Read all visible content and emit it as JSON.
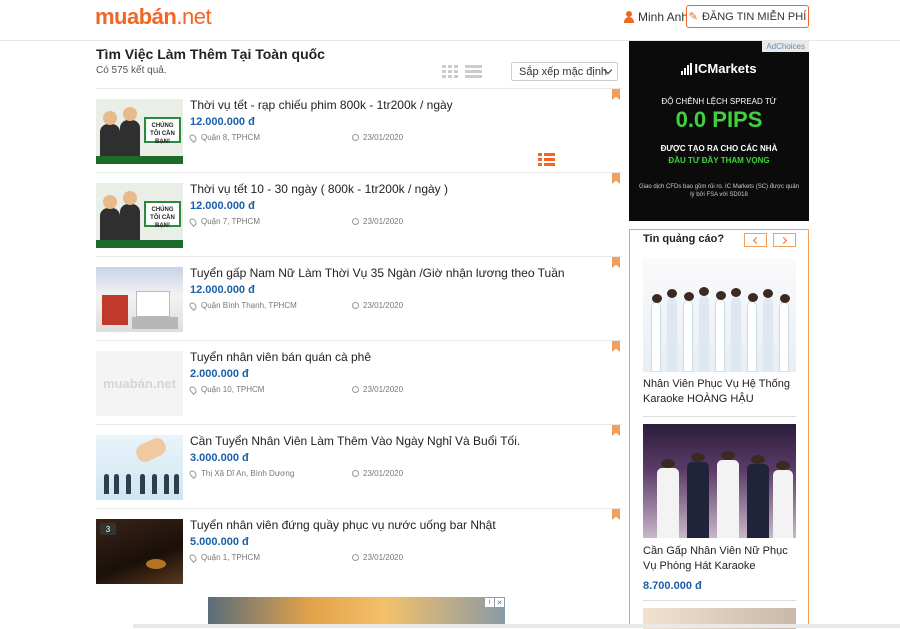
{
  "header": {
    "logo_main": "muabán",
    "logo_tld": ".net",
    "user_name": "Minh Anh",
    "post_button": "ĐĂNG TIN MIỄN PHÍ"
  },
  "listing": {
    "title": "Tìm Việc Làm Thêm Tại Toàn quốc",
    "result_count": "Có 575 kết quả.",
    "sort_label": "Sắp xếp mặc định",
    "items": [
      {
        "title": "Thời vụ tết - rạp chiếu phim 800k - 1tr200k / ngày",
        "price": "12.000.000 đ",
        "location": "Quận 8, TPHCM",
        "date": "23/01/2020",
        "thumb_text": "CHÚNG TÔI CẦN BẠN!"
      },
      {
        "title": "Thời vụ tết 10 - 30 ngày ( 800k - 1tr200k / ngày )",
        "price": "12.000.000 đ",
        "location": "Quận 7, TPHCM",
        "date": "23/01/2020",
        "thumb_text": "CHÚNG TÔI CẦN BẠN!"
      },
      {
        "title": "Tuyển gấp Nam Nữ Làm Thời Vụ 35 Ngàn /Giờ nhận lương theo Tuần",
        "price": "12.000.000 đ",
        "location": "Quận Bình Thạnh, TPHCM",
        "date": "23/01/2020"
      },
      {
        "title": "Tuyển nhân viên bán quán cà phê",
        "price": "2.000.000 đ",
        "location": "Quận 10, TPHCM",
        "date": "23/01/2020",
        "thumb_text": "muabán.net"
      },
      {
        "title": "Cần Tuyển Nhân Viên Làm Thêm Vào Ngày Nghỉ Và Buổi Tối.",
        "price": "3.000.000 đ",
        "location": "Thị Xã Dĩ An, Bình Dương",
        "date": "23/01/2020"
      },
      {
        "title": "Tuyển nhân viên đứng quầy phục vụ nước uống bar Nhật",
        "price": "5.000.000 đ",
        "location": "Quận 1, TPHCM",
        "date": "23/01/2020",
        "badge": "3"
      }
    ]
  },
  "ad_banner": {
    "adchoices": "AdChoices",
    "brand": "ICMarkets",
    "line1": "ĐỘ CHÊNH LỆCH SPREAD TỪ",
    "line2": "0.0 PIPS",
    "line3": "ĐƯỢC TẠO RA CHO CÁC NHÀ",
    "line4": "ĐẦU TƯ ĐẦY THAM VỌNG",
    "line5": "Giao dịch CFDs bao gồm rủi ro. IC Markets (SC) được quản lý bởi FSA với SD018"
  },
  "promo": {
    "heading": "Tin quảng cáo?",
    "items": [
      {
        "caption": "Nhân Viên Phục Vụ Hệ Thống Karaoke HOÀNG HẬU"
      },
      {
        "caption": "Cần Gấp Nhân Viên Nữ Phục Vụ Phòng Hát Karaoke",
        "price": "8.700.000 đ"
      }
    ]
  },
  "colors": {
    "accent": "#f26522",
    "price": "#1a5fa8",
    "pips": "#3ed33e"
  },
  "icons": [
    "user-icon",
    "pencil-icon",
    "list-view-icon",
    "grid-view-icon",
    "compact-view-icon",
    "chevron-down-icon",
    "location-pin-icon",
    "clock-icon",
    "bookmark-icon",
    "chevron-left-icon",
    "chevron-right-icon",
    "ad-close-icon"
  ]
}
